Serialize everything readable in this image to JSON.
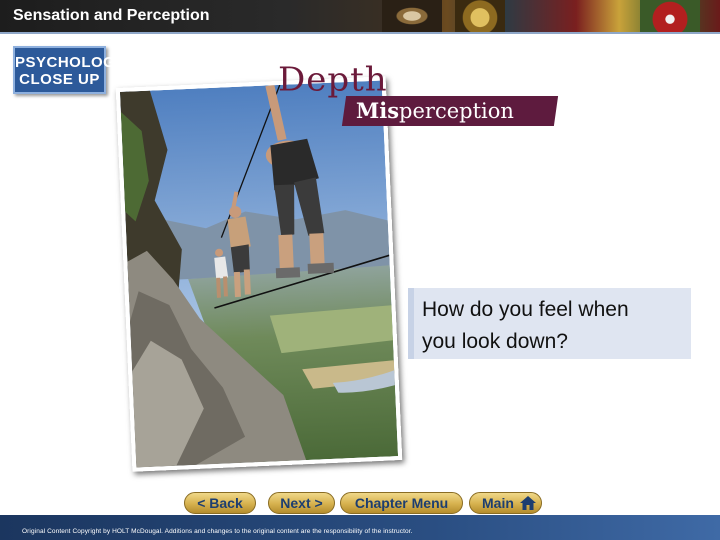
{
  "header": {
    "title": "Sensation and Perception"
  },
  "badge": {
    "line1": "PSYCHOLOGY",
    "line2": "CLOSE UP"
  },
  "heading": {
    "word": "Depth",
    "mis": "Mis",
    "rest": "perception"
  },
  "question": {
    "line1": "How do you feel when",
    "line2": "you look down?"
  },
  "navigation": {
    "back_label": "< Back",
    "next_label": "Next >",
    "chapter_label": "Chapter Menu",
    "main_label": "Main"
  },
  "footer": {
    "copyright": "Original Content Copyright by HOLT McDougal. Additions and changes to the original content are the responsibility of the instructor."
  },
  "icons": {
    "home": "home-icon"
  },
  "colors": {
    "accent_maroon": "#5e1b3e",
    "nav_gold": "#d6b14e",
    "footer_blue": "#1b365f",
    "question_bg": "#dfe5f1"
  }
}
